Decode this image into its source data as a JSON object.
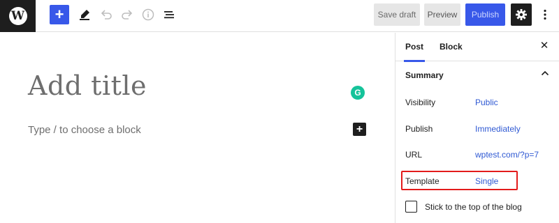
{
  "toolbar": {
    "logo_glyph": "W",
    "inserter_glyph": "+",
    "save_draft_label": "Save draft",
    "preview_label": "Preview",
    "publish_label": "Publish",
    "more_glyph": "⋮",
    "icons": [
      "wordpress-icon",
      "plus-icon",
      "pen-icon",
      "undo-icon",
      "redo-icon",
      "info-icon",
      "list-view-icon",
      "gear-icon",
      "more-vertical-icon"
    ],
    "colors": {
      "accent": "#3858e9",
      "dark": "#1e1e1e"
    }
  },
  "editor": {
    "title_placeholder": "Add title",
    "block_placeholder": "Type / to choose a block",
    "grammarly_glyph": "G",
    "block_add_glyph": "+"
  },
  "sidebar": {
    "tabs": [
      {
        "label": "Post",
        "active": true
      },
      {
        "label": "Block",
        "active": false
      }
    ],
    "close_glyph": "✕",
    "summary": {
      "heading": "Summary",
      "rows": [
        {
          "label": "Visibility",
          "value": "Public"
        },
        {
          "label": "Publish",
          "value": "Immediately"
        },
        {
          "label": "URL",
          "value": "wptest.com/?p=7"
        },
        {
          "label": "Template",
          "value": "Single"
        }
      ],
      "sticky_label": "Stick to the top of the blog",
      "sticky_checked": false
    },
    "highlight_color": "#e31b1b",
    "link_color": "#2f59d3"
  }
}
